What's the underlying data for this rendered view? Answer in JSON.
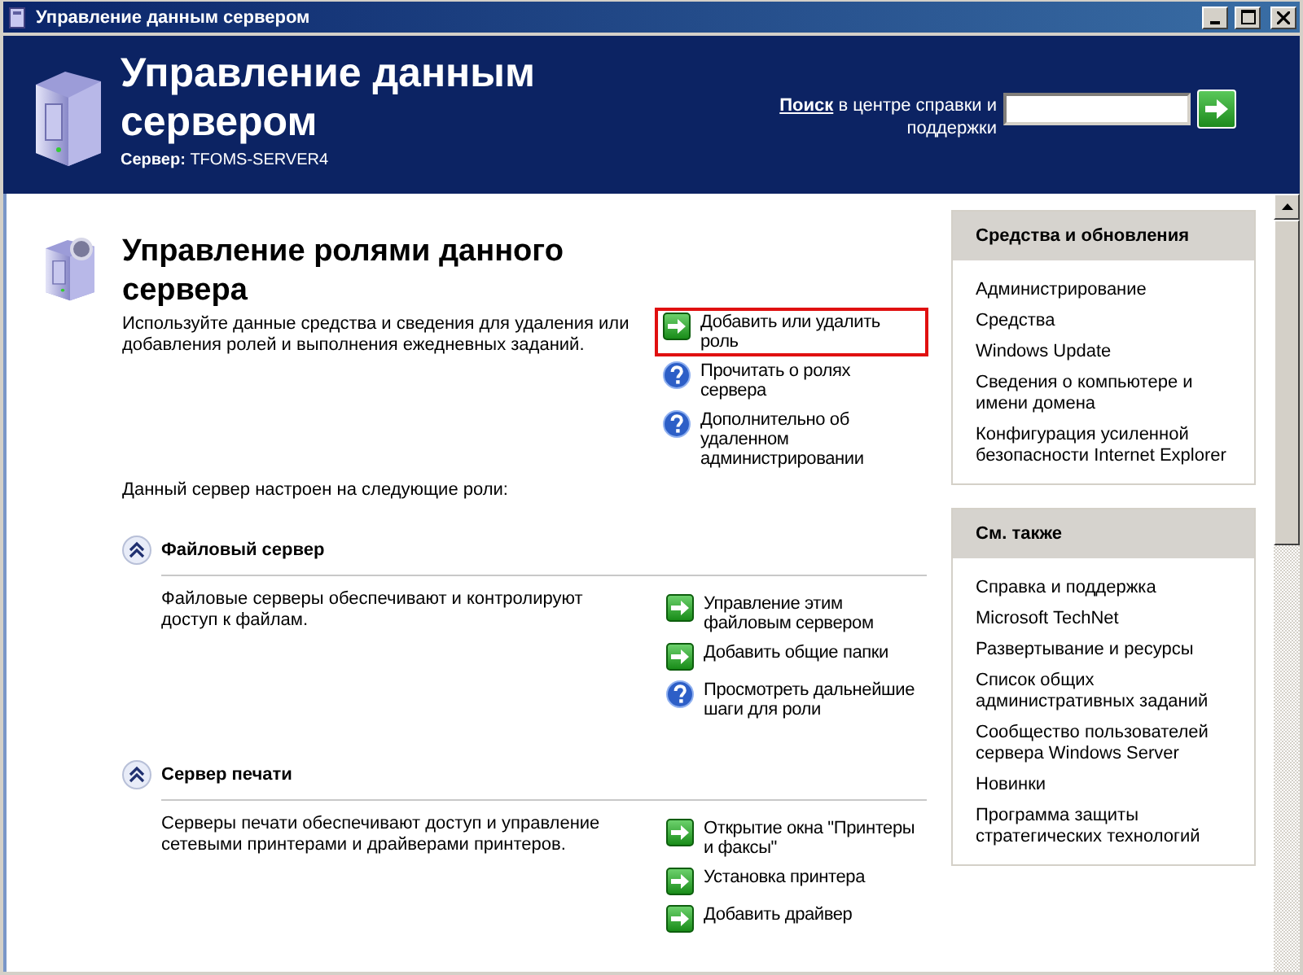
{
  "window": {
    "title": "Управление данным сервером"
  },
  "header": {
    "title": "Управление данным сервером",
    "server_label": "Сервер:",
    "server_name": "TFOMS-SERVER4",
    "search_label": "Поиск",
    "search_hint": "в центре справки и поддержки"
  },
  "roles_section": {
    "title": "Управление ролями данного сервера",
    "description": "Используйте данные средства и сведения для удаления или добавления ролей и выполнения ежедневных заданий.",
    "actions": [
      {
        "kind": "arrow",
        "label": "Добавить или удалить роль",
        "highlighted": true
      },
      {
        "kind": "help",
        "label": "Прочитать о ролях сервера",
        "highlighted": false
      },
      {
        "kind": "help",
        "label": "Дополнительно об удаленном администрировании",
        "highlighted": false
      }
    ],
    "roles_intro": "Данный сервер настроен на следующие роли:"
  },
  "roles": [
    {
      "title": "Файловый сервер",
      "expanded": true,
      "description": "Файловые серверы обеспечивают и контролируют доступ к файлам.",
      "actions": [
        {
          "kind": "arrow",
          "label": "Управление этим файловым сервером"
        },
        {
          "kind": "arrow",
          "label": "Добавить общие папки"
        },
        {
          "kind": "help",
          "label": "Просмотреть дальнейшие шаги для роли"
        }
      ]
    },
    {
      "title": "Сервер печати",
      "expanded": true,
      "description": "Серверы печати обеспечивают доступ и управление сетевыми принтерами и драйверами принтеров.",
      "actions": [
        {
          "kind": "arrow",
          "label": "Открытие окна \"Принтеры и факсы\""
        },
        {
          "kind": "arrow",
          "label": "Установка принтера"
        },
        {
          "kind": "arrow",
          "label": "Добавить драйвер"
        }
      ]
    }
  ],
  "side_panels": [
    {
      "title": "Средства и обновления",
      "items": [
        "Администрирование",
        "Средства",
        "Windows Update",
        "Сведения о компьютере и имени домена",
        "Конфигурация усиленной безопасности Internet Explorer"
      ]
    },
    {
      "title": "См. также",
      "items": [
        "Справка и поддержка",
        "Microsoft TechNet",
        "Развертывание и ресурсы",
        "Список общих административных заданий",
        "Сообщество пользователей сервера Windows Server",
        "Новинки",
        "Программа защиты стратегических технологий"
      ]
    }
  ]
}
